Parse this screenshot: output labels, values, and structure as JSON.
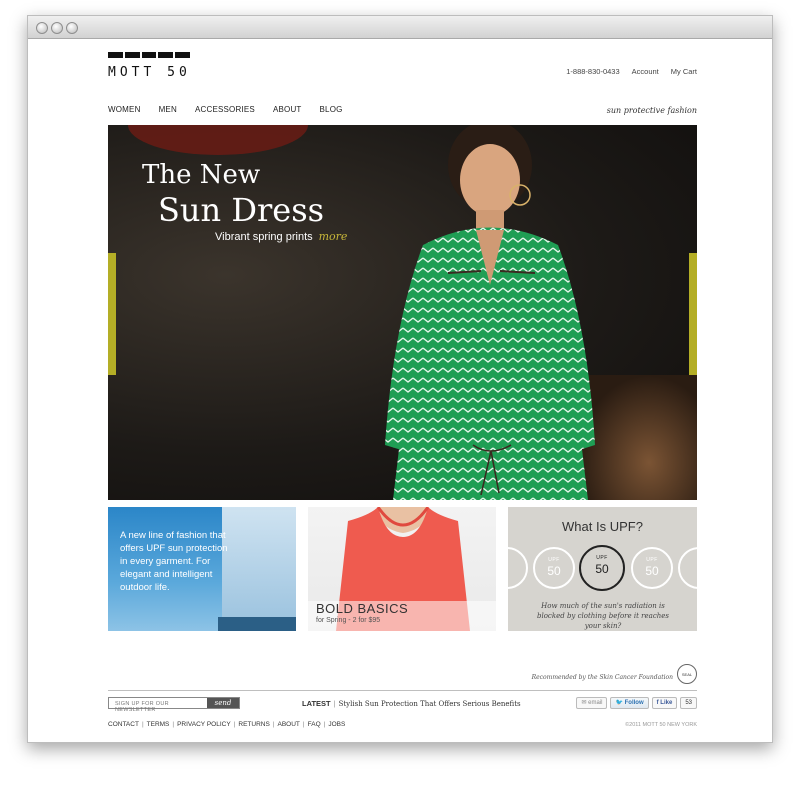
{
  "brand": {
    "name": "MOTT 50",
    "tagline": "sun protective fashion"
  },
  "utility": {
    "phone": "1-888-830-0433",
    "account": "Account",
    "cart": "My Cart"
  },
  "nav": [
    "WOMEN",
    "MEN",
    "ACCESSORIES",
    "ABOUT",
    "BLOG"
  ],
  "hero": {
    "line1": "The New",
    "line2": "Sun Dress",
    "sub": "Vibrant spring prints",
    "more": "more"
  },
  "panels": {
    "upf_intro": "A new line of fashion that offers UPF sun protection in every garment. For elegant and intelligent outdoor life.",
    "basics": {
      "title": "BOLD BASICS",
      "sub": "for Spring - 2 for $95"
    },
    "what_is": {
      "title": "What Is UPF?",
      "badges": [
        {
          "label": "UPF",
          "value": "50"
        },
        {
          "label": "UPF",
          "value": "50"
        },
        {
          "label": "UPF",
          "value": "50"
        }
      ],
      "caption": "How much of the sun's radiation is blocked by clothing before it reaches your skin?"
    }
  },
  "recommendation": "Recommended by the Skin Cancer Foundation",
  "newsletter": {
    "placeholder": "SIGN UP FOR OUR NEWSLETTER",
    "button": "send"
  },
  "latest": {
    "label": "LATEST",
    "separator": "|",
    "story": "Stylish Sun Protection That Offers Serious Benefits"
  },
  "social": {
    "email": "email",
    "follow": "Follow",
    "like": "Like",
    "like_count": "53"
  },
  "footer": {
    "links": [
      "CONTACT",
      "TERMS",
      "PRIVACY POLICY",
      "RETURNS",
      "ABOUT",
      "FAQ",
      "JOBS"
    ],
    "separator": "|",
    "copyright": "©2011 MOTT 50 NEW YORK"
  },
  "colors": {
    "accent": "#b4ae26",
    "dress": "#1f9e54",
    "sky": "#2b86c8",
    "tee": "#ef5b4f"
  }
}
